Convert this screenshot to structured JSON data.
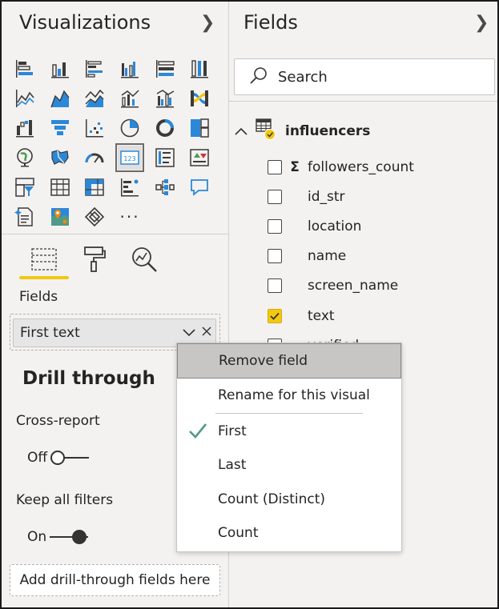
{
  "visualizations": {
    "title": "Visualizations",
    "more_label": "···",
    "tool_tabs": [
      "fields-tab",
      "format-tab",
      "analytics-tab"
    ],
    "section_label": "Fields",
    "field_well": {
      "value": "First text"
    },
    "drill_through": {
      "title": "Drill through",
      "cross_report": {
        "label": "Cross-report",
        "state_label": "Off"
      },
      "keep_all_filters": {
        "label": "Keep all filters",
        "state_label": "On"
      },
      "drop_zone": "Add drill-through fields here"
    }
  },
  "fields": {
    "title": "Fields",
    "search_placeholder": "Search",
    "table": {
      "name": "influencers",
      "items": [
        {
          "label": "followers_count",
          "checked": false,
          "aggregated": true
        },
        {
          "label": "id_str",
          "checked": false
        },
        {
          "label": "location",
          "checked": false
        },
        {
          "label": "name",
          "checked": false
        },
        {
          "label": "screen_name",
          "checked": false
        },
        {
          "label": "text",
          "checked": true
        },
        {
          "label": "verified",
          "checked": false
        }
      ]
    }
  },
  "context_menu": {
    "items": [
      {
        "label": "Remove field",
        "hovered": true
      },
      {
        "label": "Rename for this visual"
      },
      {
        "label": "First",
        "selected": true
      },
      {
        "label": "Last"
      },
      {
        "label": "Count (Distinct)"
      },
      {
        "label": "Count"
      }
    ]
  },
  "colors": {
    "accent_yellow": "#f2c811",
    "checkmark_teal": "#4f9a89",
    "icon_blue": "#2b88d8",
    "icon_dark": "#3b3a39",
    "pane_bg": "#f3f2f1"
  }
}
